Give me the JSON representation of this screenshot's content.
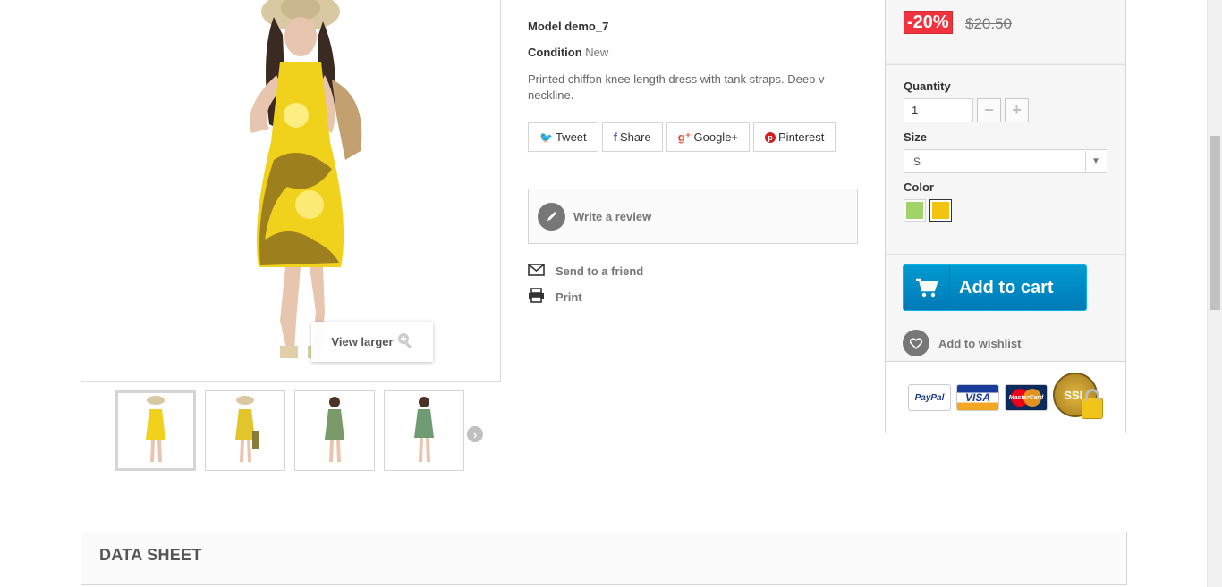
{
  "product_image": {
    "view_larger_label": "View larger",
    "thumbnail_count": 4
  },
  "info": {
    "model_label": "Model",
    "model_value": "demo_7",
    "condition_label": "Condition",
    "condition_value": "New",
    "description": "Printed chiffon knee length dress with tank straps. Deep v-neckline.",
    "share": {
      "tweet": "Tweet",
      "share": "Share",
      "google": "Google+",
      "pinterest": "Pinterest"
    },
    "write_review": "Write a review",
    "send_to_friend": "Send to a friend",
    "print": "Print"
  },
  "buy_box": {
    "discount": "-20%",
    "old_price": "$20.50",
    "quantity_label": "Quantity",
    "quantity_value": "1",
    "size_label": "Size",
    "size_value": "S",
    "color_label": "Color",
    "colors": [
      {
        "name": "Green",
        "hex": "#a0d468"
      },
      {
        "name": "Yellow",
        "hex": "#f1c40f"
      }
    ],
    "add_to_cart": "Add to cart",
    "add_to_wishlist": "Add to wishlist",
    "payment": {
      "paypal": "PayPal",
      "visa": "VISA",
      "mastercard": "MasterCard",
      "ssl": "SSL"
    }
  },
  "data_sheet": {
    "title": "DATA SHEET"
  },
  "colors": {
    "accent_blue": "#009ad0",
    "discount_red": "#f13340"
  }
}
